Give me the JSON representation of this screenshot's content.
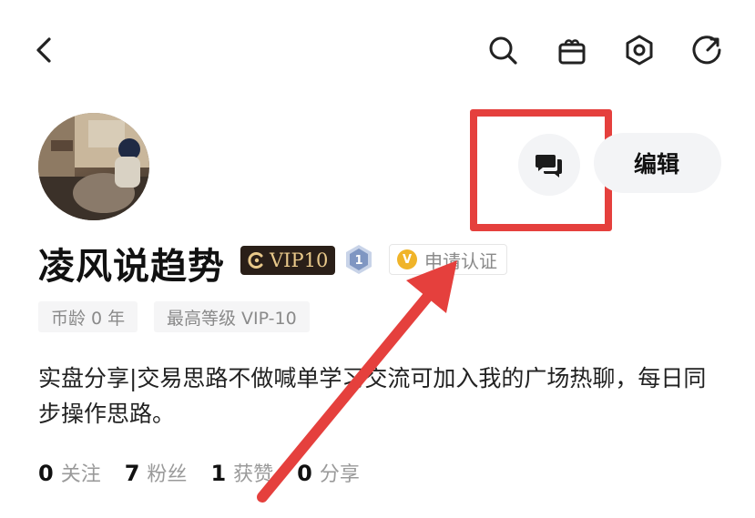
{
  "topbar": {
    "icons": [
      "back-arrow",
      "search",
      "gift",
      "settings-hex",
      "refresh"
    ]
  },
  "profile": {
    "name": "凌风说趋势",
    "vip_label": "VIP10",
    "level_number": "1",
    "verify_label": "申请认证",
    "edit_label": "编辑",
    "tags": [
      "币龄 0 年",
      "最高等级 VIP-10"
    ],
    "bio": "实盘分享|交易思路不做喊单学习交流可加入我的广场热聊，每日同步操作思路。"
  },
  "stats": [
    {
      "value": "0",
      "label": "关注"
    },
    {
      "value": "7",
      "label": "粉丝"
    },
    {
      "value": "1",
      "label": "获赞"
    },
    {
      "value": "0",
      "label": "分享"
    }
  ],
  "colors": {
    "annotation_red": "#e5403d",
    "vip_gold": "#e9c98a",
    "vip_bg": "#2a1f18",
    "verify_gold": "#f0b429",
    "chip_bg": "#f3f4f6"
  }
}
